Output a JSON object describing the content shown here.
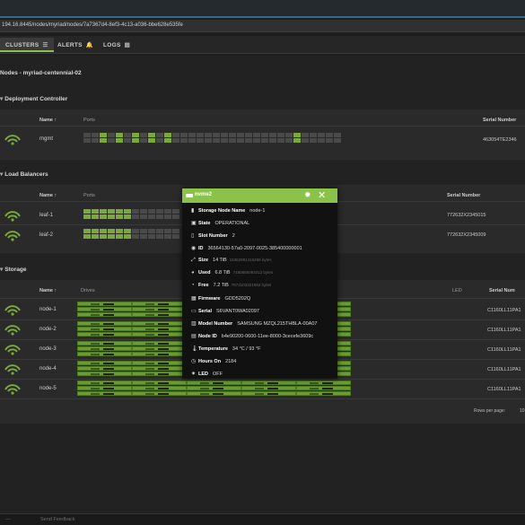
{
  "browser": {
    "url": "194.16.8445/nodes/myriad/nodes/7a7367d4-8ef3-4c13-a036-bbe628e535fe"
  },
  "nav": {
    "tabs": [
      {
        "label": "CLUSTERS",
        "icon": "list-icon",
        "active": true
      },
      {
        "label": "ALERTS",
        "icon": "bell-icon",
        "active": false
      },
      {
        "label": "LOGS",
        "icon": "log-icon",
        "active": false
      }
    ]
  },
  "breadcrumb": "Nodes - myriad-centennial-02",
  "colors": {
    "accent": "#8bc34a",
    "port_up": "#7aa83a",
    "drive": "#6d9a35",
    "background": "#222222"
  },
  "deployment": {
    "title": "Deployment Controller",
    "columns": {
      "name": "Name ↑",
      "ports": "Ports",
      "serial": "Serial Number"
    },
    "rows": [
      {
        "name": "mgmt",
        "serial": "463054TE2346"
      }
    ]
  },
  "load_balancers": {
    "title": "Load Balancers",
    "columns": {
      "name": "Name ↑",
      "ports": "Ports",
      "serial": "Serial Number"
    },
    "rows": [
      {
        "name": "leaf-1",
        "serial": "772632X2345015"
      },
      {
        "name": "leaf-2",
        "serial": "772632X2345009"
      }
    ]
  },
  "storage": {
    "title": "Storage",
    "columns": {
      "name": "Name ↑",
      "drives": "Drives",
      "led": "LED",
      "serial": "Serial Num"
    },
    "rows": [
      {
        "name": "node-1",
        "serial": "C1160LL11PA1"
      },
      {
        "name": "node-2",
        "serial": "C1160LL11PA1"
      },
      {
        "name": "node-3",
        "serial": "C1160LL11PA1"
      },
      {
        "name": "node-4",
        "serial": "C1160LL11PA1"
      },
      {
        "name": "node-5",
        "serial": "C1160LL11PA1"
      }
    ],
    "rows_per_page_label": "Rows per page:",
    "rows_per_page_value": "10"
  },
  "drive_popup": {
    "title": "nvme2",
    "fields": [
      {
        "icon": "storage-node-icon",
        "label": "Storage Node Name",
        "value": "node-1",
        "extra": ""
      },
      {
        "icon": "state-icon",
        "label": "State",
        "value": "OPERATIONAL",
        "extra": ""
      },
      {
        "icon": "slot-icon",
        "label": "Slot Number",
        "value": "2",
        "extra": ""
      },
      {
        "icon": "id-icon",
        "label": "ID",
        "value": "36564130-57a0-2097-0025-385400000001",
        "extra": ""
      },
      {
        "icon": "size-icon",
        "label": "Size",
        "value": "14 TiB",
        "extra": "15362991415296 bytes"
      },
      {
        "icon": "used-icon",
        "label": "Used",
        "value": "6.8 TiB",
        "extra": "7480885093312 bytes"
      },
      {
        "icon": "free-icon",
        "label": "Free",
        "value": "7.2 TiB",
        "extra": "7873103321984 bytes"
      },
      {
        "icon": "firmware-icon",
        "label": "Firmware",
        "value": "GDD5202Q",
        "extra": ""
      },
      {
        "icon": "serial-icon",
        "label": "Serial",
        "value": "S6VANT0WA02097",
        "extra": ""
      },
      {
        "icon": "model-icon",
        "label": "Model Number",
        "value": "SAMSUNG MZQL215THBLA-00A07",
        "extra": ""
      },
      {
        "icon": "node-id-icon",
        "label": "Node ID",
        "value": "b4e90200-0600-11ee-8000-3cecefe3609c",
        "extra": ""
      },
      {
        "icon": "thermometer-icon",
        "label": "Temperature",
        "value": "34 °C / 93 °F",
        "extra": ""
      },
      {
        "icon": "clock-icon",
        "label": "Hours On",
        "value": "2184",
        "extra": ""
      },
      {
        "icon": "led-icon",
        "label": "LED",
        "value": "OFF",
        "extra": ""
      }
    ]
  },
  "footer": {
    "send_feedback": "Send Feedback"
  }
}
